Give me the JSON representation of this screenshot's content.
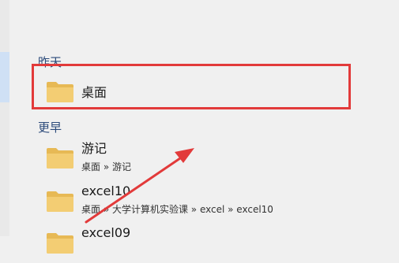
{
  "groups": {
    "yesterday": {
      "label": "昨天",
      "items": [
        {
          "name": "桌面",
          "icon": "folder-icon"
        }
      ]
    },
    "earlier": {
      "label": "更早",
      "items": [
        {
          "name": "游记",
          "path": "桌面 » 游记",
          "icon": "folder-icon"
        },
        {
          "name": "excel10",
          "path": "桌面 » 大学计算机实验课 » excel » excel10",
          "icon": "folder-icon"
        },
        {
          "name": "excel09",
          "path": "",
          "icon": "folder-icon"
        }
      ]
    }
  },
  "colors": {
    "background": "#f0f0f0",
    "group_header": "#2b4a7a",
    "folder": "#f2c96b",
    "annotation": "#e23a3a"
  }
}
